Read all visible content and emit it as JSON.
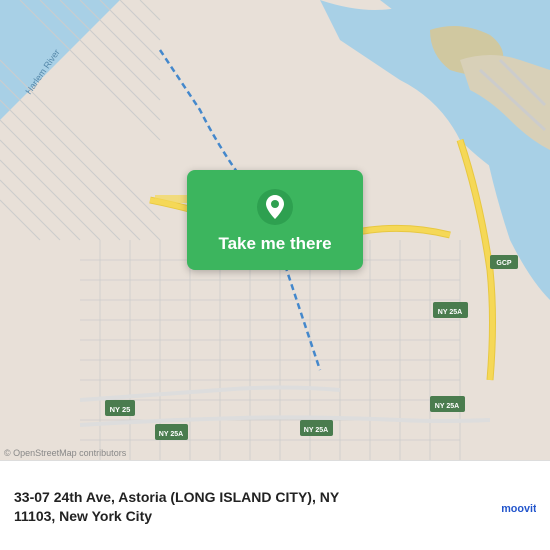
{
  "map": {
    "alt": "Map of Astoria, New York City"
  },
  "button": {
    "label": "Take me there"
  },
  "info": {
    "address_line1": "33-07 24th Ave, Astoria (LONG ISLAND CITY), NY",
    "address_line2": "11103, New York City",
    "attribution": "© OpenStreetMap contributors",
    "logo_alt": "Moovit"
  },
  "colors": {
    "green": "#3cb55e",
    "road_yellow": "#f5d857",
    "road_yellow2": "#e8c840",
    "water": "#a8d0e6",
    "land": "#e8e0d8",
    "urban": "#d8cfc8",
    "park": "#c5dba0"
  }
}
